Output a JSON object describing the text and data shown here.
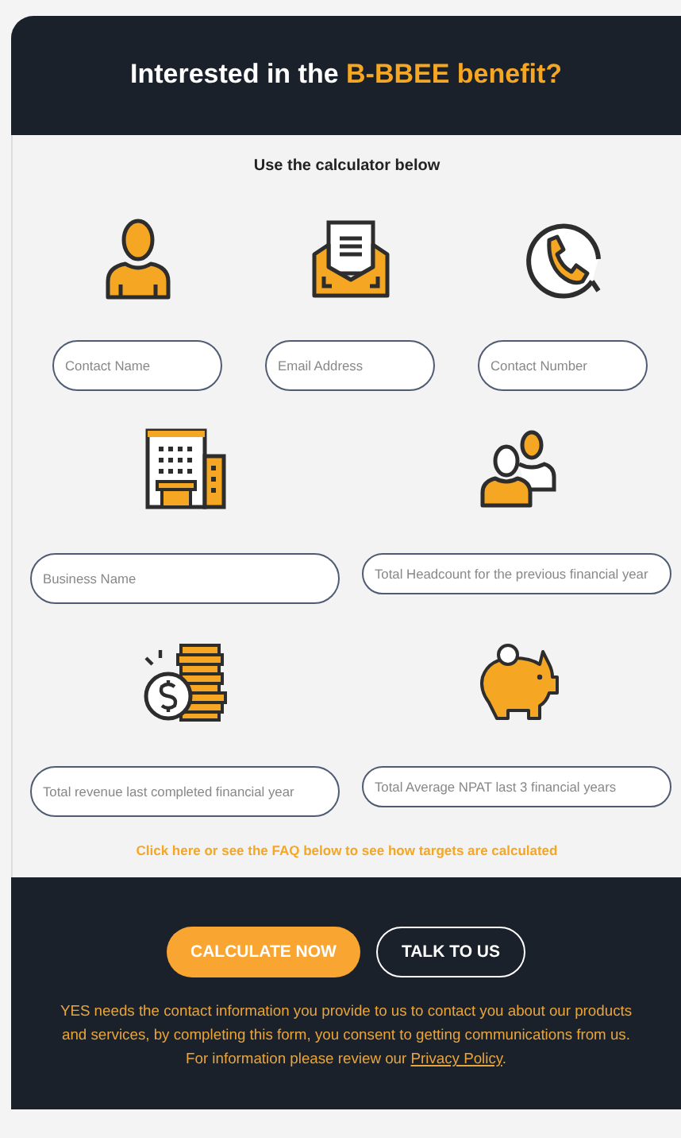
{
  "header": {
    "title_lead": "Interested in the",
    "title_highlight": "B-BBEE benefit?"
  },
  "subtitle": "Use the calculator below",
  "field_rows": [
    [
      {
        "placeholder": "Contact Name"
      },
      {
        "placeholder": "Email Address"
      },
      {
        "placeholder": "Contact Number"
      }
    ],
    [
      {
        "placeholder": "Business Name"
      },
      {
        "placeholder": "Total Headcount for the previous financial year"
      }
    ],
    [
      {
        "placeholder": "Total revenue last completed financial year"
      },
      {
        "placeholder": "Total Average NPAT last 3 financial years"
      }
    ]
  ],
  "faq_link": "Click here or see the FAQ below to see how targets are calculated",
  "buttons": [
    {
      "label": "CALCULATE NOW",
      "kind": "primary"
    },
    {
      "label": "TALK TO US",
      "kind": "outline"
    }
  ],
  "consent": {
    "text": "YES needs the contact information you provide to us to contact you about our products and services, by completing this form, you consent to getting communications from us. For information please review our ",
    "link": "Privacy Policy",
    "text_after": "."
  }
}
